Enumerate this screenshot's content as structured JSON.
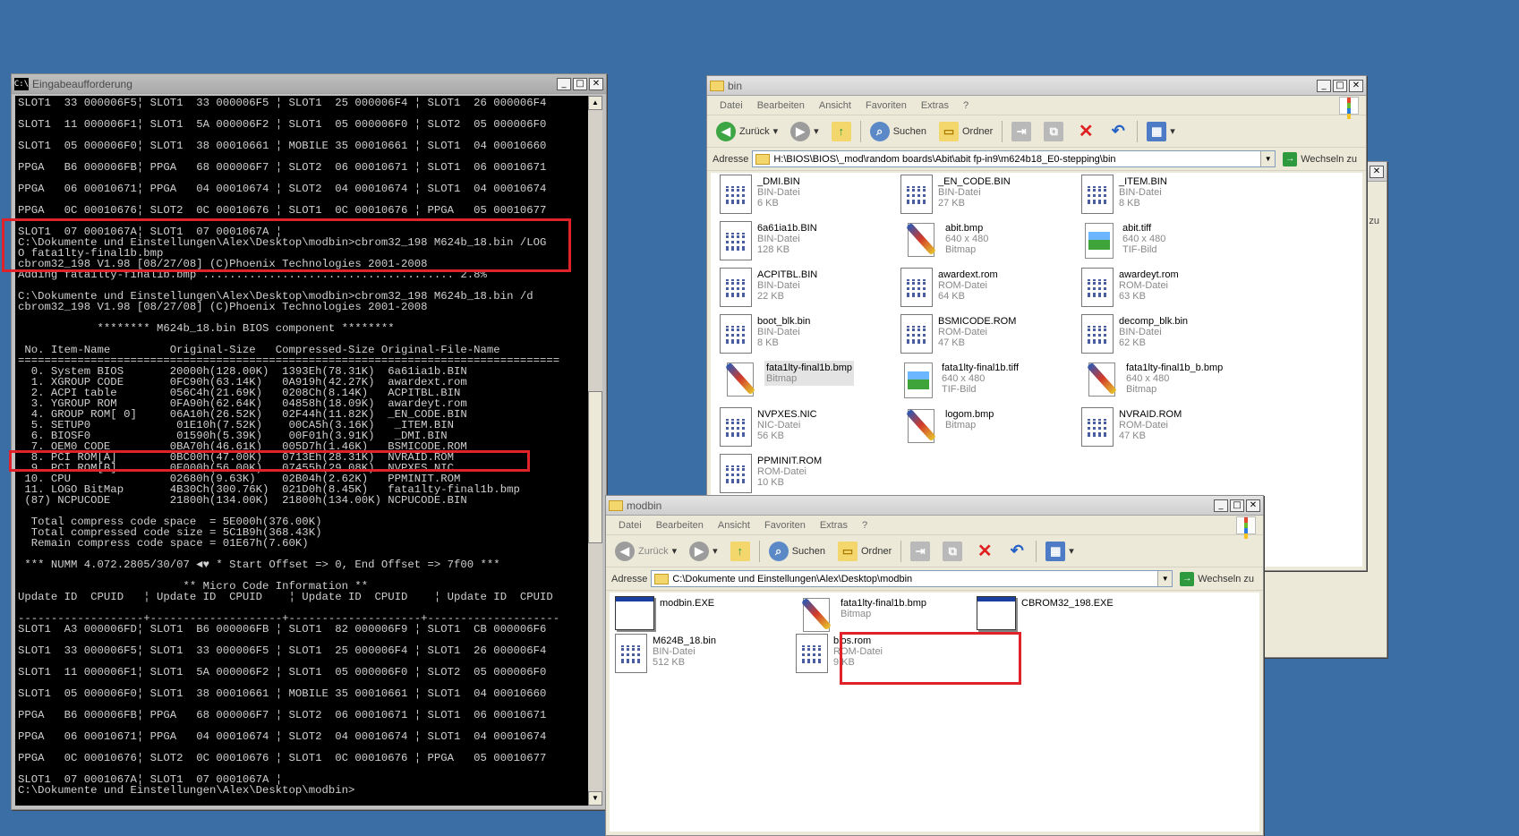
{
  "cmd": {
    "title": "Eingabeaufforderung",
    "lines": [
      "SLOT1  33 000006F5¦ SLOT1  33 000006F5 ¦ SLOT1  25 000006F4 ¦ SLOT1  26 000006F4",
      "",
      "SLOT1  11 000006F1¦ SLOT1  5A 000006F2 ¦ SLOT1  05 000006F0 ¦ SLOT2  05 000006F0",
      "",
      "SLOT1  05 000006F0¦ SLOT1  38 00010661 ¦ MOBILE 35 00010661 ¦ SLOT1  04 00010660",
      "",
      "PPGA   B6 000006FB¦ PPGA   68 000006F7 ¦ SLOT2  06 00010671 ¦ SLOT1  06 00010671",
      "",
      "PPGA   06 00010671¦ PPGA   04 00010674 ¦ SLOT2  04 00010674 ¦ SLOT1  04 00010674",
      "",
      "PPGA   0C 00010676¦ SLOT2  0C 00010676 ¦ SLOT1  0C 00010676 ¦ PPGA   05 00010677",
      "",
      "SLOT1  07 0001067A¦ SLOT1  07 0001067A ¦",
      "C:\\Dokumente und Einstellungen\\Alex\\Desktop\\modbin>cbrom32_198 M624b_18.bin /LOG",
      "O fata1lty-final1b.bmp",
      "cbrom32_198 V1.98 [08/27/08] (C)Phoenix Technologies 2001-2008",
      "Adding fata1lty-final1b.bmp ...................................... 2.8%",
      "",
      "C:\\Dokumente und Einstellungen\\Alex\\Desktop\\modbin>cbrom32_198 M624b_18.bin /d",
      "cbrom32_198 V1.98 [08/27/08] (C)Phoenix Technologies 2001-2008",
      "",
      "            ******** M624b_18.bin BIOS component ********",
      "",
      " No. Item-Name         Original-Size   Compressed-Size Original-File-Name",
      "==================================================================================",
      "  0. System BIOS       20000h(128.00K)  1393Eh(78.31K)  6a61ia1b.BIN",
      "  1. XGROUP CODE       0FC90h(63.14K)   0A919h(42.27K)  awardext.rom",
      "  2. ACPI table        056C4h(21.69K)   0208Ch(8.14K)   ACPITBL.BIN",
      "  3. YGROUP ROM        0FA90h(62.64K)   04858h(18.09K)  awardeyt.rom",
      "  4. GROUP ROM[ 0]     06A10h(26.52K)   02F44h(11.82K)  _EN_CODE.BIN",
      "  5. SETUP0             01E10h(7.52K)    00CA5h(3.16K)   _ITEM.BIN",
      "  6. BIOSF0             01590h(5.39K)    00F01h(3.91K)   _DMI.BIN",
      "  7. OEM0 CODE         0BA70h(46.61K)   005D7h(1.46K)   BSMICODE.ROM",
      "  8. PCI ROM[A]        0BC00h(47.00K)   0713Eh(28.31K)  NVRAID.ROM",
      "  9. PCI ROM[B]        0E000h(56.00K)   07455h(29.08K)  NVPXES.NIC",
      " 10. CPU               02680h(9.63K)    02B04h(2.62K)   PPMINIT.ROM",
      " 11. LOGO BitMap       4B30Ch(300.76K)  021D0h(8.45K)   fata1lty-final1b.bmp",
      " (87) NCPUCODE         21800h(134.00K)  21800h(134.00K) NCPUCODE.BIN",
      "",
      "  Total compress code space  = 5E000h(376.00K)",
      "  Total compressed code size = 5C1B9h(368.43K)",
      "  Remain compress code space = 01E67h(7.60K)",
      "",
      " *** NUMM 4.072.2805/30/07 ◄♥ * Start Offset => 0, End Offset => 7f00 ***",
      "",
      "                         ** Micro Code Information **",
      "Update ID  CPUID   ¦ Update ID  CPUID    ¦ Update ID  CPUID    ¦ Update ID  CPUID",
      "",
      "-------------------+--------------------+--------------------+--------------------",
      "SLOT1  A3 000006FD¦ SLOT1  B6 000006FB ¦ SLOT1  82 000006F9 ¦ SLOT1  CB 000006F6",
      "",
      "SLOT1  33 000006F5¦ SLOT1  33 000006F5 ¦ SLOT1  25 000006F4 ¦ SLOT1  26 000006F4",
      "",
      "SLOT1  11 000006F1¦ SLOT1  5A 000006F2 ¦ SLOT1  05 000006F0 ¦ SLOT2  05 000006F0",
      "",
      "SLOT1  05 000006F0¦ SLOT1  38 00010661 ¦ MOBILE 35 00010661 ¦ SLOT1  04 00010660",
      "",
      "PPGA   B6 000006FB¦ PPGA   68 000006F7 ¦ SLOT2  06 00010671 ¦ SLOT1  06 00010671",
      "",
      "PPGA   06 00010671¦ PPGA   04 00010674 ¦ SLOT2  04 00010674 ¦ SLOT1  04 00010674",
      "",
      "PPGA   0C 00010676¦ SLOT2  0C 00010676 ¦ SLOT1  0C 00010676 ¦ PPGA   05 00010677",
      "",
      "SLOT1  07 0001067A¦ SLOT1  07 0001067A ¦",
      "C:\\Dokumente und Einstellungen\\Alex\\Desktop\\modbin>"
    ]
  },
  "explorer_bin": {
    "title": "bin",
    "menu": [
      "Datei",
      "Bearbeiten",
      "Ansicht",
      "Favoriten",
      "Extras",
      "?"
    ],
    "toolbar": {
      "back": "Zurück",
      "search": "Suchen",
      "folders": "Ordner"
    },
    "address_label": "Adresse",
    "address": "H:\\BIOS\\BIOS\\_mod\\random boards\\Abit\\abit fp-in9\\m624b18_E0-stepping\\bin",
    "go": "Wechseln zu",
    "files": [
      {
        "name": "_DMI.BIN",
        "type": "BIN-Datei",
        "size": "6 KB",
        "icon": "bin"
      },
      {
        "name": "_EN_CODE.BIN",
        "type": "BIN-Datei",
        "size": "27 KB",
        "icon": "bin"
      },
      {
        "name": "_ITEM.BIN",
        "type": "BIN-Datei",
        "size": "8 KB",
        "icon": "bin"
      },
      {
        "name": "6a61ia1b.BIN",
        "type": "BIN-Datei",
        "size": "128 KB",
        "icon": "bin"
      },
      {
        "name": "abit.bmp",
        "type": "640 x 480",
        "size": "Bitmap",
        "icon": "bmp"
      },
      {
        "name": "abit.tiff",
        "type": "640 x 480",
        "size": "TIF-Bild",
        "icon": "tif"
      },
      {
        "name": "ACPITBL.BIN",
        "type": "BIN-Datei",
        "size": "22 KB",
        "icon": "bin"
      },
      {
        "name": "awardext.rom",
        "type": "ROM-Datei",
        "size": "64 KB",
        "icon": "bin"
      },
      {
        "name": "awardeyt.rom",
        "type": "ROM-Datei",
        "size": "63 KB",
        "icon": "bin"
      },
      {
        "name": "boot_blk.bin",
        "type": "BIN-Datei",
        "size": "8 KB",
        "icon": "bin"
      },
      {
        "name": "BSMICODE.ROM",
        "type": "ROM-Datei",
        "size": "47 KB",
        "icon": "bin"
      },
      {
        "name": "decomp_blk.bin",
        "type": "BIN-Datei",
        "size": "62 KB",
        "icon": "bin"
      },
      {
        "name": "fata1lty-final1b.bmp",
        "type": "Bitmap",
        "size": "",
        "icon": "bmp"
      },
      {
        "name": "fata1lty-final1b.tiff",
        "type": "640 x 480",
        "size": "TIF-Bild",
        "icon": "tif"
      },
      {
        "name": "fata1lty-final1b_b.bmp",
        "type": "640 x 480",
        "size": "Bitmap",
        "icon": "bmp"
      },
      {
        "name": "NVPXES.NIC",
        "type": "NIC-Datei",
        "size": "56 KB",
        "icon": "bin"
      },
      {
        "name": "logom.bmp",
        "type": "Bitmap",
        "size": "",
        "icon": "bmp"
      },
      {
        "name": "NVRAID.ROM",
        "type": "ROM-Datei",
        "size": "47 KB",
        "icon": "bin"
      },
      {
        "name": "PPMINIT.ROM",
        "type": "ROM-Datei",
        "size": "10 KB",
        "icon": "bin"
      }
    ]
  },
  "explorer_modbin": {
    "title": "modbin",
    "menu": [
      "Datei",
      "Bearbeiten",
      "Ansicht",
      "Favoriten",
      "Extras",
      "?"
    ],
    "toolbar": {
      "back": "Zurück",
      "search": "Suchen",
      "folders": "Ordner"
    },
    "address_label": "Adresse",
    "address": "C:\\Dokumente und Einstellungen\\Alex\\Desktop\\modbin",
    "go": "Wechseln zu",
    "files": [
      {
        "name": "modbin.EXE",
        "type": "",
        "size": "",
        "icon": "exe"
      },
      {
        "name": "fata1lty-final1b.bmp",
        "type": "Bitmap",
        "size": "",
        "icon": "bmp"
      },
      {
        "name": "CBROM32_198.EXE",
        "type": "",
        "size": "",
        "icon": "exe"
      },
      {
        "name": "M624B_18.bin",
        "type": "BIN-Datei",
        "size": "512 KB",
        "icon": "bin"
      },
      {
        "name": "bios.rom",
        "type": "ROM-Datei",
        "size": "9 KB",
        "icon": "bin"
      }
    ]
  },
  "behind_window": {
    "label": "zu"
  },
  "glyphs": {
    "minimize": "_",
    "maximize": "□",
    "close": "✕",
    "cmd_icon": "C:\\",
    "dropdown": "▼",
    "scroll_up": "▲",
    "scroll_down": "▼",
    "go_arrow": "→"
  },
  "colors": {
    "desktop": "#3a6ea5",
    "highlight": "#e0222b"
  }
}
